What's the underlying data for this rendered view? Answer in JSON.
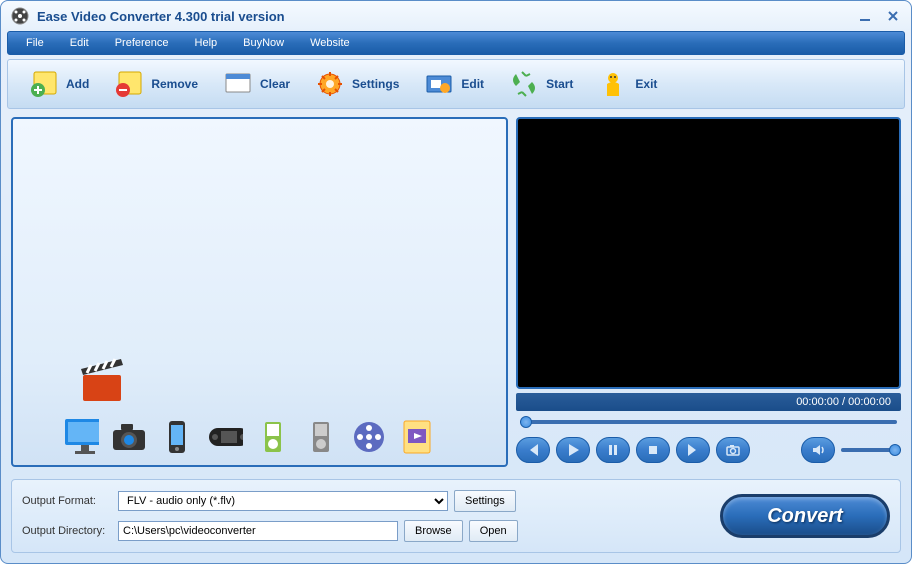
{
  "title": "Ease Video Converter 4.300  trial version",
  "menu": {
    "file": "File",
    "edit": "Edit",
    "preference": "Preference",
    "help": "Help",
    "buynow": "BuyNow",
    "website": "Website"
  },
  "toolbar": {
    "add": "Add",
    "remove": "Remove",
    "clear": "Clear",
    "settings": "Settings",
    "edit": "Edit",
    "start": "Start",
    "exit": "Exit"
  },
  "player": {
    "time": "00:00:00 / 00:00:00"
  },
  "output": {
    "format_label": "Output Format:",
    "format_value": "FLV - audio only (*.flv)",
    "settings_btn": "Settings",
    "directory_label": "Output Directory:",
    "directory_value": "C:\\Users\\pc\\videoconverter",
    "browse_btn": "Browse",
    "open_btn": "Open"
  },
  "convert_label": "Convert"
}
